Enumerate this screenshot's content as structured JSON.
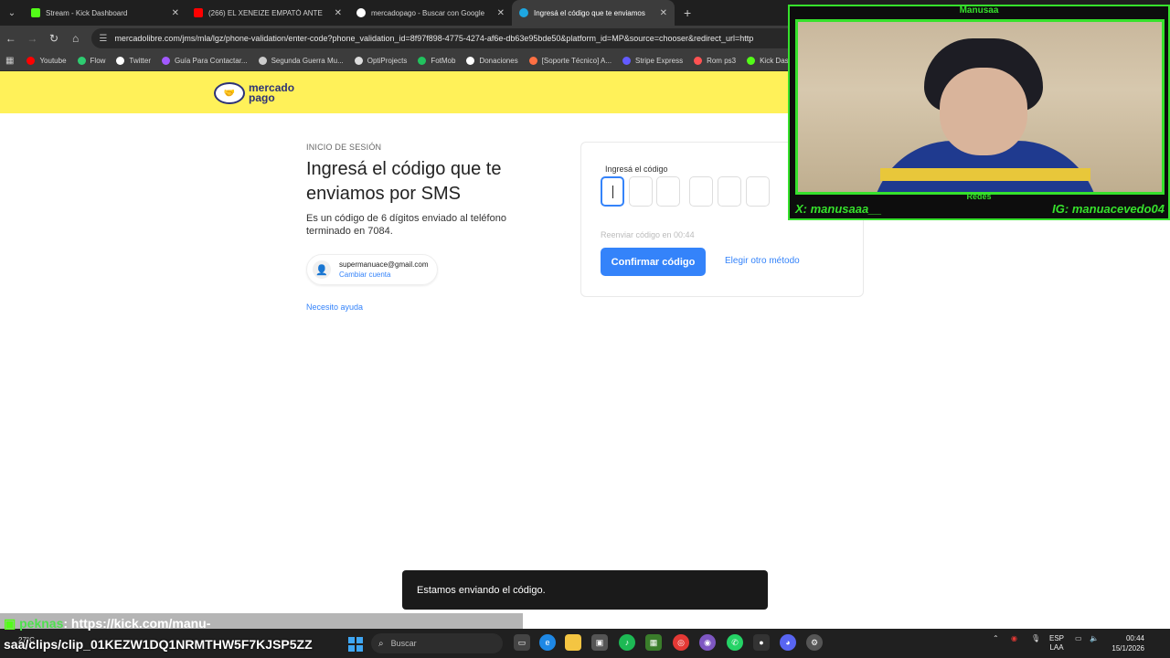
{
  "browser": {
    "tabs": [
      {
        "title": "Stream - Kick Dashboard",
        "color": "#53fc18"
      },
      {
        "title": "(266) EL XENEIZE EMPATÓ ANTE",
        "color": "#ff0000"
      },
      {
        "title": "mercadopago - Buscar con Google",
        "color": "#ffffff"
      },
      {
        "title": "Ingresá el código que te enviamos",
        "color": "#1ea7e1"
      }
    ],
    "url": "mercadolibre.com/jms/mla/lgz/phone-validation/enter-code?phone_validation_id=8f97f898-4775-4274-af6e-db63e95bde50&platform_id=MP&source=chooser&redirect_url=http",
    "bookmarks": [
      {
        "label": "Youtube",
        "color": "#ff0000"
      },
      {
        "label": "Flow",
        "color": "#2ecc71"
      },
      {
        "label": "Twitter",
        "color": "#ffffff"
      },
      {
        "label": "Guía Para Contactar...",
        "color": "#a259ff"
      },
      {
        "label": "Segunda Guerra Mu...",
        "color": "#cccccc"
      },
      {
        "label": "OptiProjects",
        "color": "#dddddd"
      },
      {
        "label": "FotMob",
        "color": "#21c25e"
      },
      {
        "label": "Donaciones",
        "color": "#ffffff"
      },
      {
        "label": "[Soporte Técnico] A...",
        "color": "#ff7043"
      },
      {
        "label": "Stripe Express",
        "color": "#635bff"
      },
      {
        "label": "Rom ps3",
        "color": "#ff5252"
      },
      {
        "label": "Kick Das",
        "color": "#53fc18"
      }
    ]
  },
  "page": {
    "logo_line1": "mercado",
    "logo_line2": "pago",
    "overline": "INICIO DE SESIÓN",
    "heading": "Ingresá el código que te enviamos por SMS",
    "description": "Es un código de 6 dígitos enviado al teléfono terminado en 7084.",
    "account_email": "supermanuace@gmail.com",
    "account_change": "Cambiar cuenta",
    "help_link": "Necesito ayuda",
    "code_label": "Ingresá el código",
    "resend": "Reenviar código en 00:44",
    "confirm_button": "Confirmar código",
    "other_method": "Elegir otro método",
    "toast": "Estamos enviando el código.",
    "accent": "#3483fa",
    "header_color": "#fff159"
  },
  "overlay": {
    "cam_title": "Manusaa",
    "redes": "Redes",
    "twitter": "X: manusaaa__",
    "instagram": "IG: manuacevedo04",
    "chat_user": "peknas",
    "chat_text_1": ": https://kick.com/manu-",
    "chat_text_2": "saa/clips/clip_01KEZW1DQ1NRMTHW5F7KJSP5ZZ"
  },
  "taskbar": {
    "weather": "27°C",
    "search_placeholder": "Buscar",
    "lang_1": "ESP",
    "lang_2": "LAA",
    "time": "00:44",
    "date": "15/1/2026"
  }
}
